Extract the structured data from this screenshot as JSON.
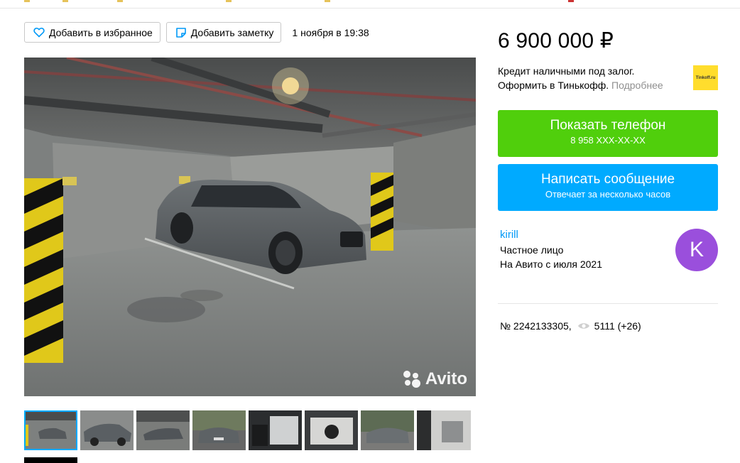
{
  "actions": {
    "favorite_label": "Добавить в избранное",
    "note_label": "Добавить заметку",
    "date": "1 ноября в 19:38"
  },
  "gallery": {
    "watermark": "Avito",
    "thumbnail_count": 8,
    "active_index": 0
  },
  "price": "6 900 000 ₽",
  "credit": {
    "line1": "Кредит наличными под залог.",
    "line2": "Оформить в Тинькофф.",
    "more": "Подробнее",
    "logo_text": "Tinkoff.ru"
  },
  "buttons": {
    "phone_label": "Показать телефон",
    "phone_number": "8 958 XXX-XX-XX",
    "message_label": "Написать сообщение",
    "message_sub": "Отвечает за несколько часов"
  },
  "seller": {
    "name": "kirill",
    "type": "Частное лицо",
    "since": "На Авито с июля 2021",
    "avatar_letter": "K"
  },
  "listing": {
    "number": "№ 2242133305,",
    "views": "5111 (+26)"
  },
  "colors": {
    "green": "#50cf0c",
    "blue": "#00aaff",
    "avatar": "#9a4fdc",
    "tinkoff_yellow": "#ffdd2d"
  }
}
